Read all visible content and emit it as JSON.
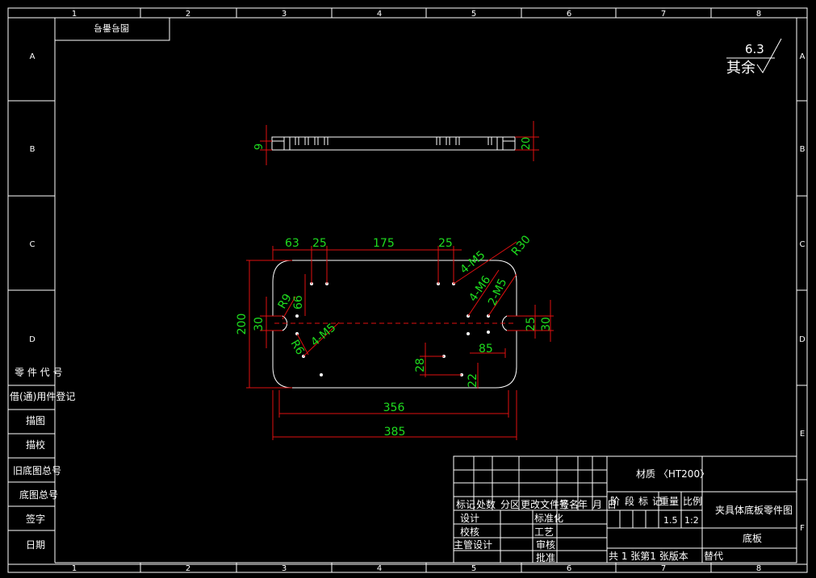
{
  "colors": {
    "background": "#000000",
    "lines": "#ffffff",
    "dimension_lines": "#e01010",
    "dimension_text": "#1fdc1f"
  },
  "border": {
    "col_numbers": [
      "1",
      "2",
      "3",
      "4",
      "5",
      "6",
      "7",
      "8"
    ],
    "row_letters": [
      "A",
      "B",
      "C",
      "D",
      "E",
      "F"
    ]
  },
  "top_left_title": "图号番号",
  "roughness": {
    "value": "6.3",
    "label": "其余"
  },
  "dimensions": {
    "side_left": "9",
    "side_right": "20",
    "top_63": "63",
    "top_25a": "25",
    "top_175": "175",
    "top_25b": "25",
    "r30": "R30",
    "m5_a": "4-M5",
    "m6": "4-M6",
    "m5_b": "2-M5",
    "r9": "R9",
    "d66": "66",
    "d200": "200",
    "d30_left": "30",
    "r6": "R6",
    "m5_c": "4-M5",
    "d25_right": "25",
    "d30_right": "30",
    "d85": "85",
    "d28": "28",
    "d22": "22",
    "d356": "356",
    "d385": "385"
  },
  "left_column": [
    "零 件 代 号",
    "借(通)用件登记",
    "描图",
    "描校",
    "旧底图总号",
    "底图总号",
    "签字",
    "日期"
  ],
  "title_block": {
    "header_row": [
      "标记",
      "处数",
      "分区",
      "更改文件号",
      "签名",
      "年",
      "月",
      "日"
    ],
    "rows": [
      [
        "设计",
        "标准化"
      ],
      [
        "校核",
        "工艺"
      ],
      [
        "主管设计",
        "审核"
      ],
      [
        "",
        "批准"
      ]
    ],
    "material": "材质 〈HT200〉",
    "stage_labels": [
      "阶",
      "段",
      "标",
      "记"
    ],
    "weight_label": "重量",
    "scale_label": "比例",
    "weight_value": "1.5",
    "scale_value": "1:2",
    "drawing_title": "夹具体底板零件图",
    "part_name": "底板",
    "sheet_info": "共 1 张第1 张版本",
    "replace_label": "替代"
  }
}
